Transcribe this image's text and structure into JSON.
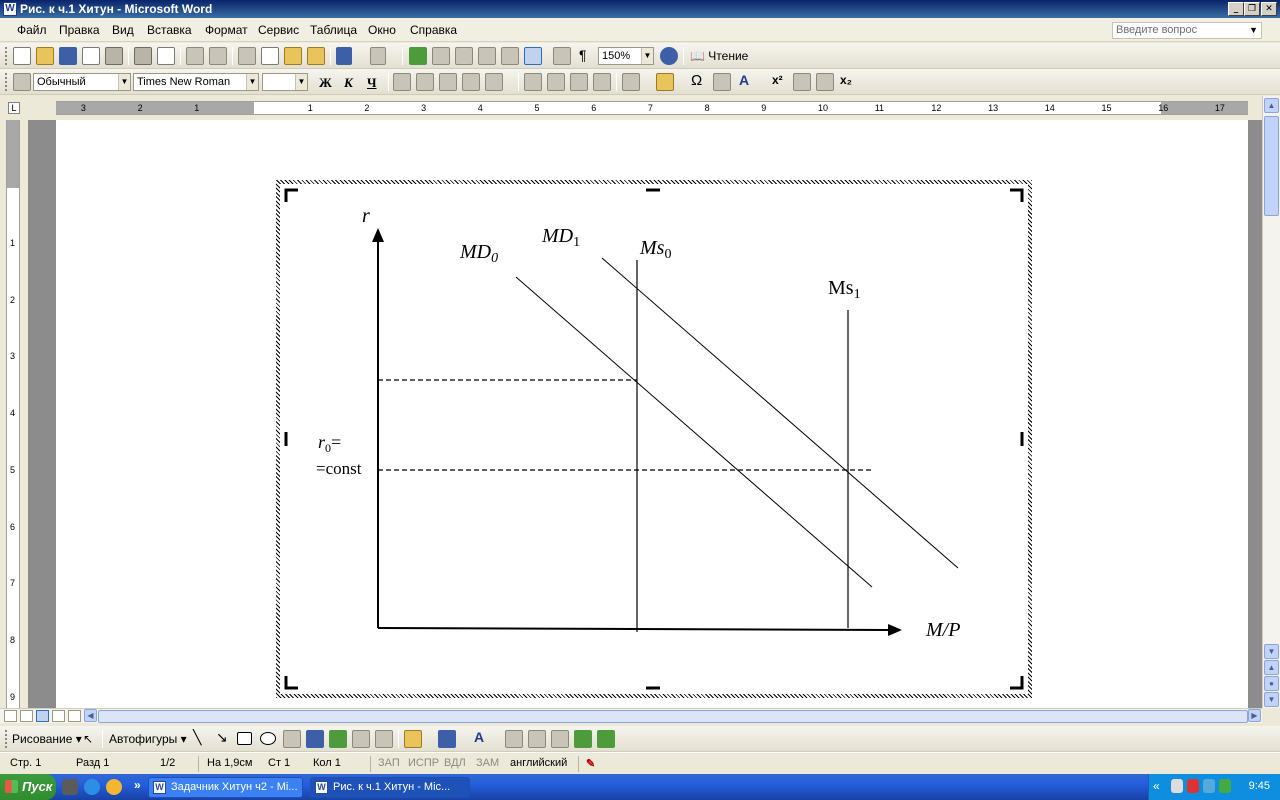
{
  "window": {
    "title": "Рис. к ч.1 Хитун - Microsoft Word",
    "app_icon": "W"
  },
  "menu": {
    "items": [
      "Файл",
      "Правка",
      "Вид",
      "Вставка",
      "Формат",
      "Сервис",
      "Таблица",
      "Окно",
      "Справка"
    ],
    "ask_placeholder": "Введите вопрос"
  },
  "toolbar": {
    "zoom": "150%",
    "reading_label": "Чтение"
  },
  "formatting": {
    "style": "Обычный",
    "font": "Times New Roman",
    "size": "",
    "bold": "Ж",
    "italic": "К",
    "underline": "Ч"
  },
  "ruler": {
    "h_left": [
      "3",
      "2",
      "1"
    ],
    "h_right": [
      "1",
      "2",
      "3",
      "4",
      "5",
      "6",
      "7",
      "8",
      "9",
      "10",
      "11",
      "12",
      "13",
      "14",
      "15",
      "16",
      "17"
    ],
    "v": [
      "1",
      "2",
      "3",
      "4",
      "5",
      "6",
      "7",
      "8",
      "9"
    ]
  },
  "diagram": {
    "y_axis_label": "r",
    "x_axis_label": "M/P",
    "md0_label": "MD",
    "md0_sub": "0",
    "md1_label": "MD",
    "md1_sub": "1",
    "ms0_label": "Ms",
    "ms0_sub": "0",
    "ms1_label": "Ms",
    "ms1_sub": "1",
    "r0_label_a": "r",
    "r0_label_sub": "0",
    "r0_label_b": "=",
    "r0_label_c": "=const"
  },
  "drawing_bar": {
    "draw_label": "Рисование",
    "autoshapes_label": "Автофигуры"
  },
  "status": {
    "page": "Стр. 1",
    "section": "Разд 1",
    "pages": "1/2",
    "at": "На 1,9см",
    "line": "Ст 1",
    "col": "Кол 1",
    "rec": "ЗАП",
    "trk": "ИСПР",
    "ext": "ВДЛ",
    "ovr": "ЗАМ",
    "lang": "английский"
  },
  "taskbar": {
    "start": "Пуск",
    "task1": "Задачник Хитун ч2 - Mi...",
    "task2": "Рис. к ч.1 Хитун - Mic...",
    "clock": "9:45"
  }
}
